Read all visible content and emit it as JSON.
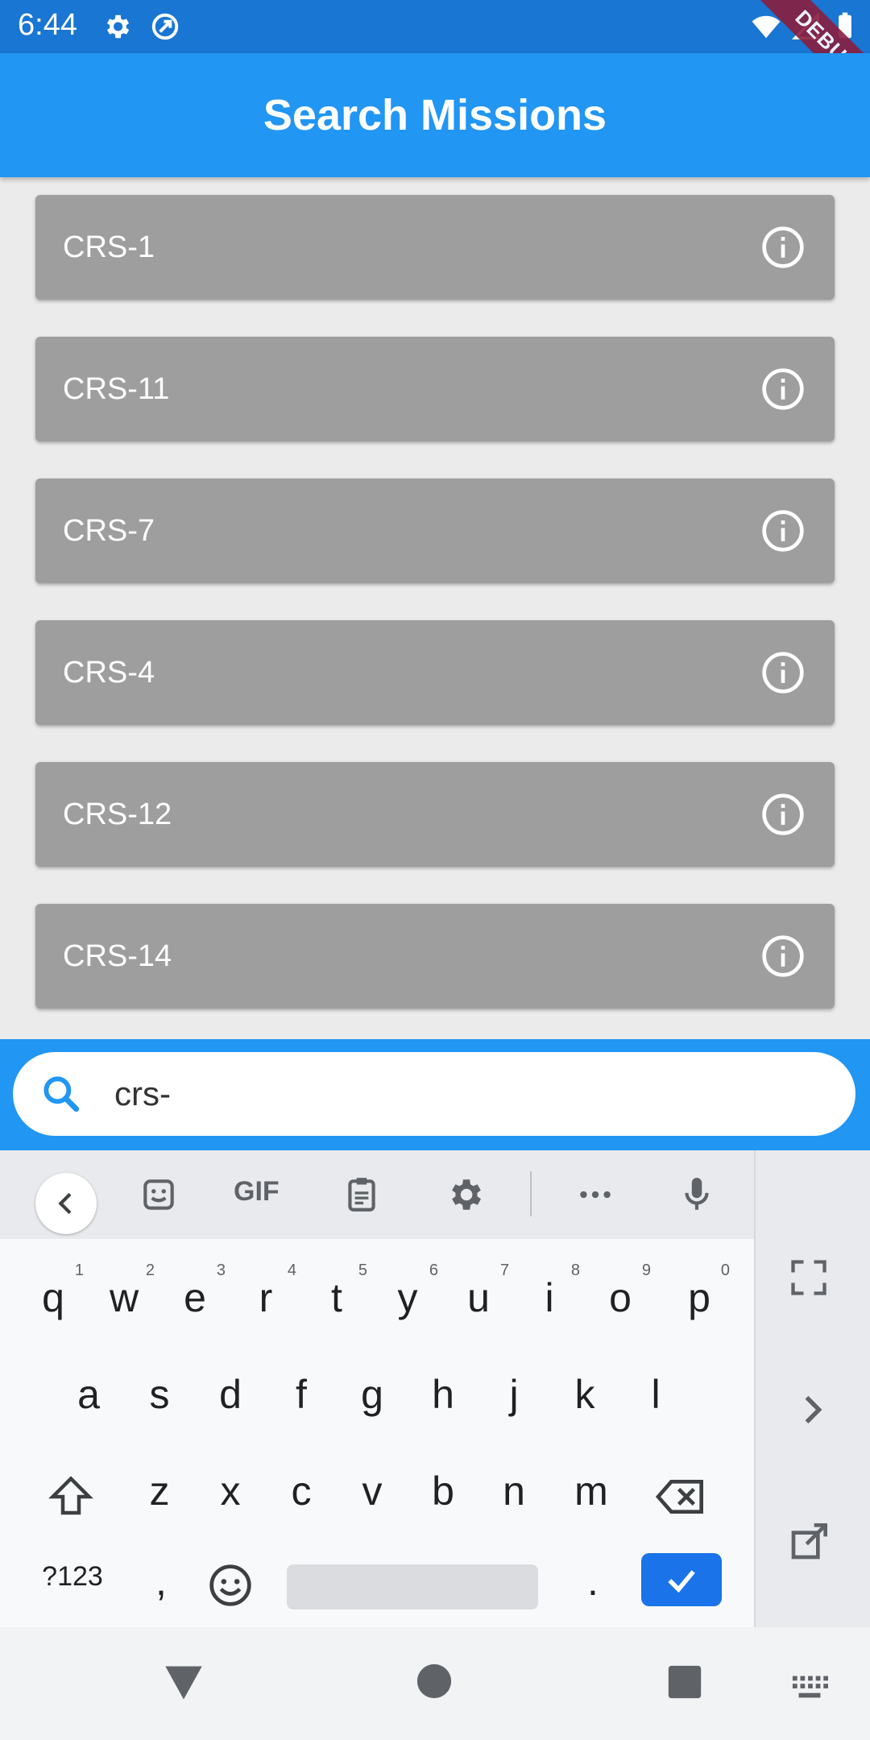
{
  "status_bar": {
    "time": "6:44",
    "debug_label": "DEBUG",
    "icons": [
      "gear-icon",
      "sync-icon",
      "wifi-icon",
      "signal-icon",
      "battery-icon"
    ]
  },
  "app_bar": {
    "title": "Search Missions"
  },
  "missions": [
    {
      "label": "CRS-1"
    },
    {
      "label": "CRS-11"
    },
    {
      "label": "CRS-7"
    },
    {
      "label": "CRS-4"
    },
    {
      "label": "CRS-12"
    },
    {
      "label": "CRS-14"
    }
  ],
  "search": {
    "value": "crs-"
  },
  "keyboard": {
    "toolbar_gif": "GIF",
    "row1": [
      {
        "k": "q",
        "n": "1"
      },
      {
        "k": "w",
        "n": "2"
      },
      {
        "k": "e",
        "n": "3"
      },
      {
        "k": "r",
        "n": "4"
      },
      {
        "k": "t",
        "n": "5"
      },
      {
        "k": "y",
        "n": "6"
      },
      {
        "k": "u",
        "n": "7"
      },
      {
        "k": "i",
        "n": "8"
      },
      {
        "k": "o",
        "n": "9"
      },
      {
        "k": "p",
        "n": "0"
      }
    ],
    "row2": [
      "a",
      "s",
      "d",
      "f",
      "g",
      "h",
      "j",
      "k",
      "l"
    ],
    "row3": [
      "z",
      "x",
      "c",
      "v",
      "b",
      "n",
      "m"
    ],
    "symbols_key": "?123",
    "comma_key": ",",
    "period_key": "."
  },
  "colors": {
    "status_bar": "#1976d2",
    "app_bar": "#2196f3",
    "card": "#9e9e9e",
    "accent": "#1a73e8"
  }
}
